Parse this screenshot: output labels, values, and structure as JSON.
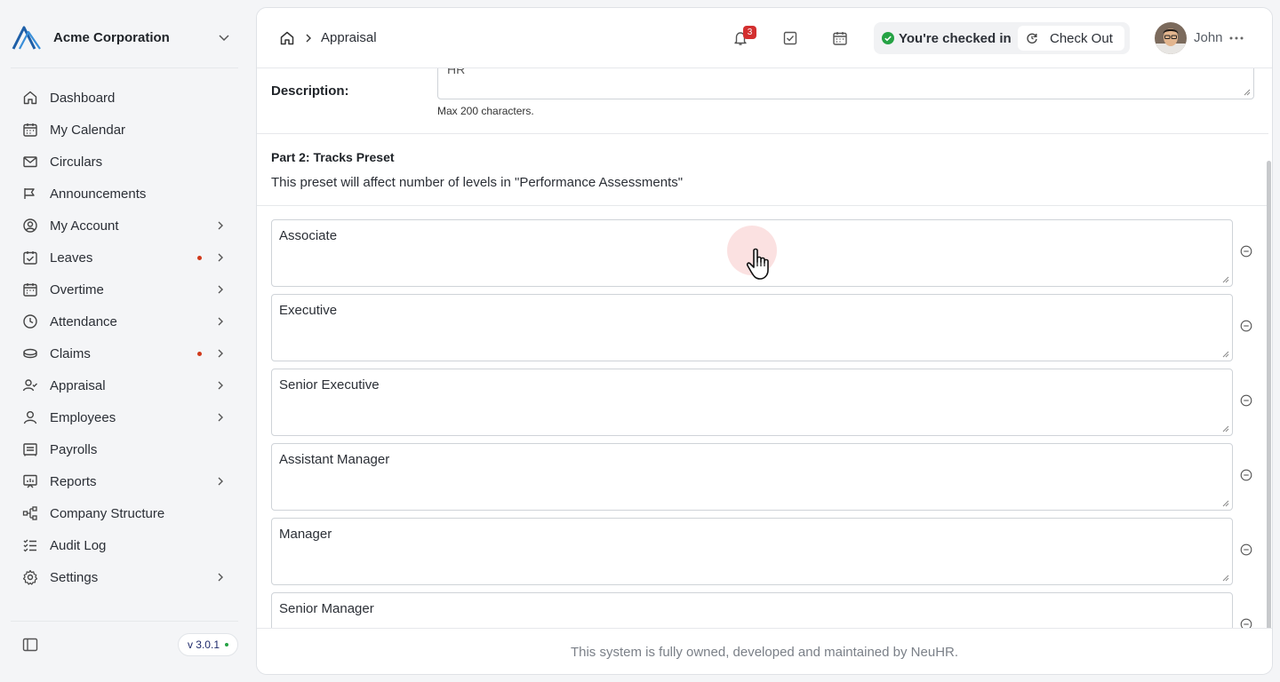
{
  "org": {
    "name": "Acme Corporation"
  },
  "sidebar": {
    "items": [
      {
        "label": "Dashboard"
      },
      {
        "label": "My Calendar"
      },
      {
        "label": "Circulars"
      },
      {
        "label": "Announcements"
      },
      {
        "label": "My Account"
      },
      {
        "label": "Leaves"
      },
      {
        "label": "Overtime"
      },
      {
        "label": "Attendance"
      },
      {
        "label": "Claims"
      },
      {
        "label": "Appraisal"
      },
      {
        "label": "Employees"
      },
      {
        "label": "Payrolls"
      },
      {
        "label": "Reports"
      },
      {
        "label": "Company Structure"
      },
      {
        "label": "Audit Log"
      },
      {
        "label": "Settings"
      }
    ],
    "version": "v 3.0.1"
  },
  "header": {
    "breadcrumb": "Appraisal",
    "notification_count": "3",
    "checkin_status": "You're checked in",
    "checkout_label": "Check Out",
    "user_name": "John"
  },
  "form": {
    "description_label": "Description:",
    "description_value": "HR",
    "description_hint": "Max 200 characters.",
    "part2_title": "Part 2: Tracks Preset",
    "part2_subtitle": "This preset will affect number of levels in \"Performance Assessments\"",
    "levels": [
      {
        "value": "Associate"
      },
      {
        "value": "Executive"
      },
      {
        "value": "Senior Executive"
      },
      {
        "value": "Assistant Manager"
      },
      {
        "value": "Manager"
      },
      {
        "value": "Senior Manager"
      }
    ]
  },
  "footer": {
    "text": "This system is fully owned, developed and maintained by NeuHR."
  },
  "colors": {
    "brand": "#1e5fa8",
    "alert": "#d32f2f",
    "success": "#25a244"
  }
}
